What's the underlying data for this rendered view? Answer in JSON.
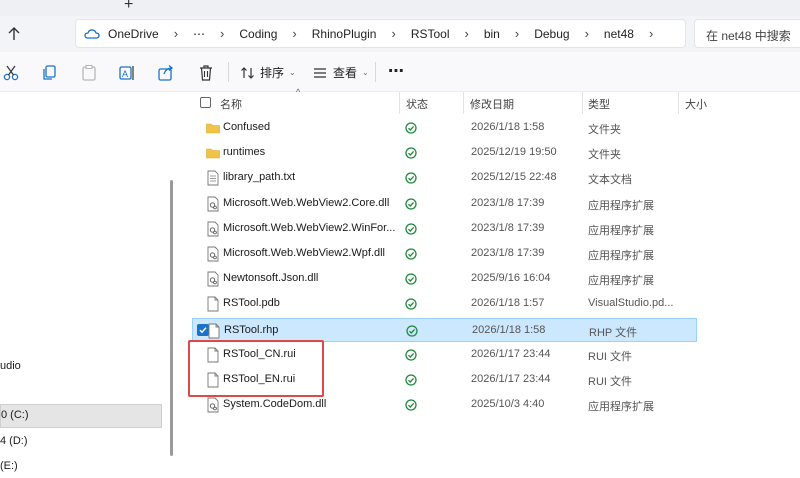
{
  "tab": {
    "new_tab": "+"
  },
  "address": {
    "crumbs": [
      "OneDrive",
      "⋯",
      "Coding",
      "RhinoPlugin",
      "RSTool",
      "bin",
      "Debug",
      "net48"
    ],
    "search_placeholder": "在 net48 中搜索"
  },
  "toolbar": {
    "sort_label": "排序",
    "view_label": "查看",
    "more_label": "⋯"
  },
  "nav": {
    "items": [
      "udio",
      "0 (C:)",
      "4 (D:)",
      "(E:)"
    ]
  },
  "columns": {
    "name": "名称",
    "status": "状态",
    "modified": "修改日期",
    "type": "类型",
    "size": "大小"
  },
  "files": [
    {
      "name": "Confused",
      "date": "2026/1/18 1:58",
      "type": "文件夹",
      "icon": "folder"
    },
    {
      "name": "runtimes",
      "date": "2025/12/19 19:50",
      "type": "文件夹",
      "icon": "folder"
    },
    {
      "name": "library_path.txt",
      "date": "2025/12/15 22:48",
      "type": "文本文档",
      "icon": "text"
    },
    {
      "name": "Microsoft.Web.WebView2.Core.dll",
      "date": "2023/1/8 17:39",
      "type": "应用程序扩展",
      "icon": "dll"
    },
    {
      "name": "Microsoft.Web.WebView2.WinFor...",
      "date": "2023/1/8 17:39",
      "type": "应用程序扩展",
      "icon": "dll"
    },
    {
      "name": "Microsoft.Web.WebView2.Wpf.dll",
      "date": "2023/1/8 17:39",
      "type": "应用程序扩展",
      "icon": "dll"
    },
    {
      "name": "Newtonsoft.Json.dll",
      "date": "2025/9/16 16:04",
      "type": "应用程序扩展",
      "icon": "dll"
    },
    {
      "name": "RSTool.pdb",
      "date": "2026/1/18 1:57",
      "type": "VisualStudio.pd...",
      "icon": "file"
    },
    {
      "name": "RSTool.rhp",
      "date": "2026/1/18 1:58",
      "type": "RHP 文件",
      "icon": "file",
      "selected": true
    },
    {
      "name": "RSTool_CN.rui",
      "date": "2026/1/17 23:44",
      "type": "RUI 文件",
      "icon": "file"
    },
    {
      "name": "RSTool_EN.rui",
      "date": "2026/1/17 23:44",
      "type": "RUI 文件",
      "icon": "file"
    },
    {
      "name": "System.CodeDom.dll",
      "date": "2025/10/3 4:40",
      "type": "应用程序扩展",
      "icon": "dll"
    }
  ],
  "colors": {
    "selection": "#cce8ff",
    "highlight": "#e04848",
    "folder": "#f2c349",
    "status_ok": "#1f8a3b"
  }
}
